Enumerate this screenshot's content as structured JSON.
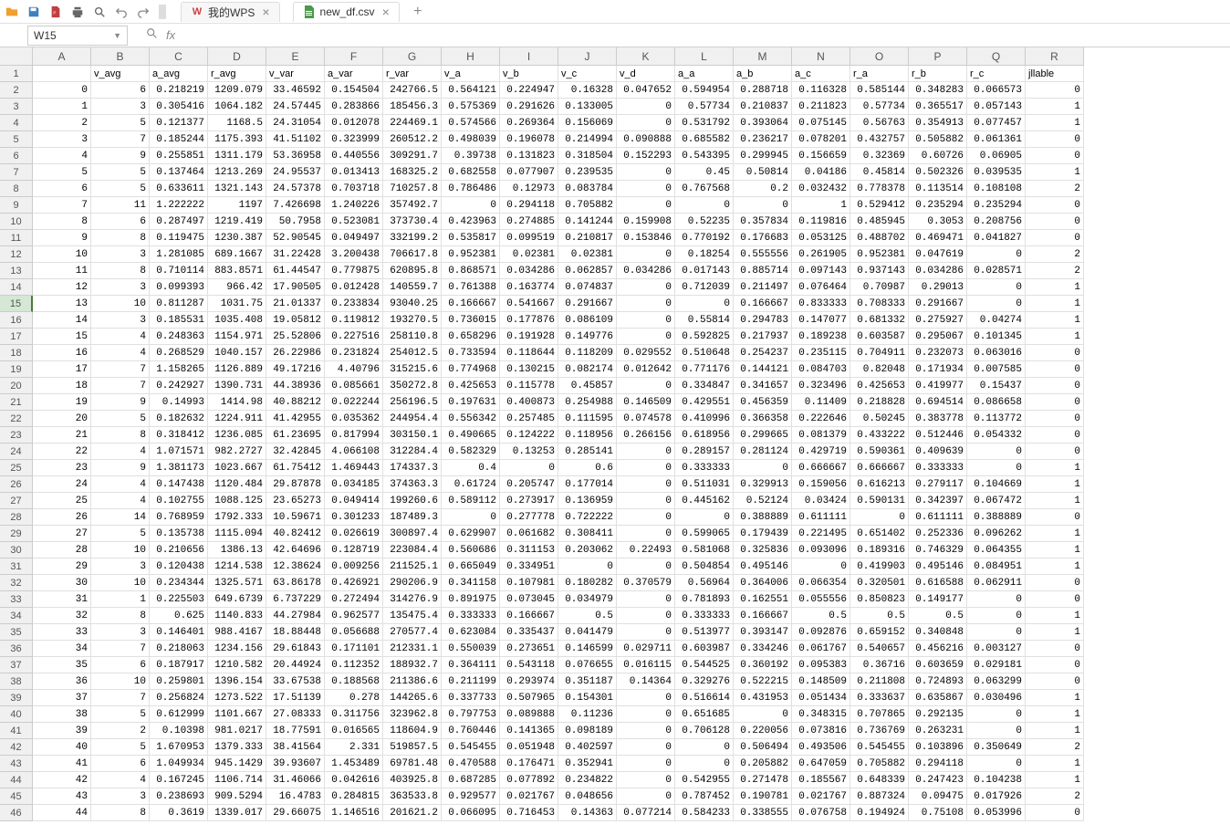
{
  "toolbar": {
    "tabs": [
      {
        "label": "我的WPS",
        "active": false,
        "closable": true,
        "icon": "wps"
      },
      {
        "label": "new_df.csv",
        "active": true,
        "closable": true,
        "icon": "csv"
      }
    ]
  },
  "namebox": {
    "value": "W15"
  },
  "formula": {
    "label": "fx",
    "value": ""
  },
  "columns": [
    "A",
    "B",
    "C",
    "D",
    "E",
    "F",
    "G",
    "H",
    "I",
    "J",
    "K",
    "L",
    "M",
    "N",
    "O",
    "P",
    "Q",
    "R"
  ],
  "selected": {
    "row": 15,
    "col": "W"
  },
  "headers_row": [
    "",
    "v_avg",
    "a_avg",
    "r_avg",
    "v_var",
    "a_var",
    "r_var",
    "v_a",
    "v_b",
    "v_c",
    "v_d",
    "a_a",
    "a_b",
    "a_c",
    "r_a",
    "r_b",
    "r_c",
    "jllable"
  ],
  "data_rows": [
    [
      "0",
      "6",
      "0.218219",
      "1209.079",
      "33.46592",
      "0.154504",
      "242766.5",
      "0.564121",
      "0.224947",
      "0.16328",
      "0.047652",
      "0.594954",
      "0.288718",
      "0.116328",
      "0.585144",
      "0.348283",
      "0.066573",
      "0"
    ],
    [
      "1",
      "3",
      "0.305416",
      "1064.182",
      "24.57445",
      "0.283866",
      "185456.3",
      "0.575369",
      "0.291626",
      "0.133005",
      "0",
      "0.57734",
      "0.210837",
      "0.211823",
      "0.57734",
      "0.365517",
      "0.057143",
      "1"
    ],
    [
      "2",
      "5",
      "0.121377",
      "1168.5",
      "24.31054",
      "0.012078",
      "224469.1",
      "0.574566",
      "0.269364",
      "0.156069",
      "0",
      "0.531792",
      "0.393064",
      "0.075145",
      "0.56763",
      "0.354913",
      "0.077457",
      "1"
    ],
    [
      "3",
      "7",
      "0.185244",
      "1175.393",
      "41.51102",
      "0.323999",
      "260512.2",
      "0.498039",
      "0.196078",
      "0.214994",
      "0.090888",
      "0.685582",
      "0.236217",
      "0.078201",
      "0.432757",
      "0.505882",
      "0.061361",
      "0"
    ],
    [
      "4",
      "9",
      "0.255851",
      "1311.179",
      "53.36958",
      "0.440556",
      "309291.7",
      "0.39738",
      "0.131823",
      "0.318504",
      "0.152293",
      "0.543395",
      "0.299945",
      "0.156659",
      "0.32369",
      "0.60726",
      "0.06905",
      "0"
    ],
    [
      "5",
      "5",
      "0.137464",
      "1213.269",
      "24.95537",
      "0.013413",
      "168325.2",
      "0.682558",
      "0.077907",
      "0.239535",
      "0",
      "0.45",
      "0.50814",
      "0.04186",
      "0.45814",
      "0.502326",
      "0.039535",
      "1"
    ],
    [
      "6",
      "5",
      "0.633611",
      "1321.143",
      "24.57378",
      "0.703718",
      "710257.8",
      "0.786486",
      "0.12973",
      "0.083784",
      "0",
      "0.767568",
      "0.2",
      "0.032432",
      "0.778378",
      "0.113514",
      "0.108108",
      "2"
    ],
    [
      "7",
      "11",
      "1.222222",
      "1197",
      "7.426698",
      "1.240226",
      "357492.7",
      "0",
      "0.294118",
      "0.705882",
      "0",
      "0",
      "0",
      "1",
      "0.529412",
      "0.235294",
      "0.235294",
      "0"
    ],
    [
      "8",
      "6",
      "0.287497",
      "1219.419",
      "50.7958",
      "0.523081",
      "373730.4",
      "0.423963",
      "0.274885",
      "0.141244",
      "0.159908",
      "0.52235",
      "0.357834",
      "0.119816",
      "0.485945",
      "0.3053",
      "0.208756",
      "0"
    ],
    [
      "9",
      "8",
      "0.119475",
      "1230.387",
      "52.90545",
      "0.049497",
      "332199.2",
      "0.535817",
      "0.099519",
      "0.210817",
      "0.153846",
      "0.770192",
      "0.176683",
      "0.053125",
      "0.488702",
      "0.469471",
      "0.041827",
      "0"
    ],
    [
      "10",
      "3",
      "1.281085",
      "689.1667",
      "31.22428",
      "3.200438",
      "706617.8",
      "0.952381",
      "0.02381",
      "0.02381",
      "0",
      "0.18254",
      "0.555556",
      "0.261905",
      "0.952381",
      "0.047619",
      "0",
      "2"
    ],
    [
      "11",
      "8",
      "0.710114",
      "883.8571",
      "61.44547",
      "0.779875",
      "620895.8",
      "0.868571",
      "0.034286",
      "0.062857",
      "0.034286",
      "0.017143",
      "0.885714",
      "0.097143",
      "0.937143",
      "0.034286",
      "0.028571",
      "2"
    ],
    [
      "12",
      "3",
      "0.099393",
      "966.42",
      "17.90505",
      "0.012428",
      "140559.7",
      "0.761388",
      "0.163774",
      "0.074837",
      "0",
      "0.712039",
      "0.211497",
      "0.076464",
      "0.70987",
      "0.29013",
      "0",
      "1"
    ],
    [
      "13",
      "10",
      "0.811287",
      "1031.75",
      "21.01337",
      "0.233834",
      "93040.25",
      "0.166667",
      "0.541667",
      "0.291667",
      "0",
      "0",
      "0.166667",
      "0.833333",
      "0.708333",
      "0.291667",
      "0",
      "1"
    ],
    [
      "14",
      "3",
      "0.185531",
      "1035.408",
      "19.05812",
      "0.119812",
      "193270.5",
      "0.736015",
      "0.177876",
      "0.086109",
      "0",
      "0.55814",
      "0.294783",
      "0.147077",
      "0.681332",
      "0.275927",
      "0.04274",
      "1"
    ],
    [
      "15",
      "4",
      "0.248363",
      "1154.971",
      "25.52806",
      "0.227516",
      "258110.8",
      "0.658296",
      "0.191928",
      "0.149776",
      "0",
      "0.592825",
      "0.217937",
      "0.189238",
      "0.603587",
      "0.295067",
      "0.101345",
      "1"
    ],
    [
      "16",
      "4",
      "0.268529",
      "1040.157",
      "26.22986",
      "0.231824",
      "254012.5",
      "0.733594",
      "0.118644",
      "0.118209",
      "0.029552",
      "0.510648",
      "0.254237",
      "0.235115",
      "0.704911",
      "0.232073",
      "0.063016",
      "0"
    ],
    [
      "17",
      "7",
      "1.158265",
      "1126.889",
      "49.17216",
      "4.40796",
      "315215.6",
      "0.774968",
      "0.130215",
      "0.082174",
      "0.012642",
      "0.771176",
      "0.144121",
      "0.084703",
      "0.82048",
      "0.171934",
      "0.007585",
      "0"
    ],
    [
      "18",
      "7",
      "0.242927",
      "1390.731",
      "44.38936",
      "0.085661",
      "350272.8",
      "0.425653",
      "0.115778",
      "0.45857",
      "0",
      "0.334847",
      "0.341657",
      "0.323496",
      "0.425653",
      "0.419977",
      "0.15437",
      "0"
    ],
    [
      "19",
      "9",
      "0.14993",
      "1414.98",
      "40.88212",
      "0.022244",
      "256196.5",
      "0.197631",
      "0.400873",
      "0.254988",
      "0.146509",
      "0.429551",
      "0.456359",
      "0.11409",
      "0.218828",
      "0.694514",
      "0.086658",
      "0"
    ],
    [
      "20",
      "5",
      "0.182632",
      "1224.911",
      "41.42955",
      "0.035362",
      "244954.4",
      "0.556342",
      "0.257485",
      "0.111595",
      "0.074578",
      "0.410996",
      "0.366358",
      "0.222646",
      "0.50245",
      "0.383778",
      "0.113772",
      "0"
    ],
    [
      "21",
      "8",
      "0.318412",
      "1236.085",
      "61.23695",
      "0.817994",
      "303150.1",
      "0.490665",
      "0.124222",
      "0.118956",
      "0.266156",
      "0.618956",
      "0.299665",
      "0.081379",
      "0.433222",
      "0.512446",
      "0.054332",
      "0"
    ],
    [
      "22",
      "4",
      "1.071571",
      "982.2727",
      "32.42845",
      "4.066108",
      "312284.4",
      "0.582329",
      "0.13253",
      "0.285141",
      "0",
      "0.289157",
      "0.281124",
      "0.429719",
      "0.590361",
      "0.409639",
      "0",
      "0"
    ],
    [
      "23",
      "9",
      "1.381173",
      "1023.667",
      "61.75412",
      "1.469443",
      "174337.3",
      "0.4",
      "0",
      "0.6",
      "0",
      "0.333333",
      "0",
      "0.666667",
      "0.666667",
      "0.333333",
      "0",
      "1"
    ],
    [
      "24",
      "4",
      "0.147438",
      "1120.484",
      "29.87878",
      "0.034185",
      "374363.3",
      "0.61724",
      "0.205747",
      "0.177014",
      "0",
      "0.511031",
      "0.329913",
      "0.159056",
      "0.616213",
      "0.279117",
      "0.104669",
      "1"
    ],
    [
      "25",
      "4",
      "0.102755",
      "1088.125",
      "23.65273",
      "0.049414",
      "199260.6",
      "0.589112",
      "0.273917",
      "0.136959",
      "0",
      "0.445162",
      "0.52124",
      "0.03424",
      "0.590131",
      "0.342397",
      "0.067472",
      "1"
    ],
    [
      "26",
      "14",
      "0.768959",
      "1792.333",
      "10.59671",
      "0.301233",
      "187489.3",
      "0",
      "0.277778",
      "0.722222",
      "0",
      "0",
      "0.388889",
      "0.611111",
      "0",
      "0.611111",
      "0.388889",
      "0"
    ],
    [
      "27",
      "5",
      "0.135738",
      "1115.094",
      "40.82412",
      "0.026619",
      "300897.4",
      "0.629907",
      "0.061682",
      "0.308411",
      "0",
      "0.599065",
      "0.179439",
      "0.221495",
      "0.651402",
      "0.252336",
      "0.096262",
      "1"
    ],
    [
      "28",
      "10",
      "0.210656",
      "1386.13",
      "42.64696",
      "0.128719",
      "223084.4",
      "0.560686",
      "0.311153",
      "0.203062",
      "0.22493",
      "0.581068",
      "0.325836",
      "0.093096",
      "0.189316",
      "0.746329",
      "0.064355",
      "1"
    ],
    [
      "29",
      "3",
      "0.120438",
      "1214.538",
      "12.38624",
      "0.009256",
      "211525.1",
      "0.665049",
      "0.334951",
      "0",
      "0",
      "0.504854",
      "0.495146",
      "0",
      "0.419903",
      "0.495146",
      "0.084951",
      "1"
    ],
    [
      "30",
      "10",
      "0.234344",
      "1325.571",
      "63.86178",
      "0.426921",
      "290206.9",
      "0.341158",
      "0.107981",
      "0.180282",
      "0.370579",
      "0.56964",
      "0.364006",
      "0.066354",
      "0.320501",
      "0.616588",
      "0.062911",
      "0"
    ],
    [
      "31",
      "1",
      "0.225503",
      "649.6739",
      "6.737229",
      "0.272494",
      "314276.9",
      "0.891975",
      "0.073045",
      "0.034979",
      "0",
      "0.781893",
      "0.162551",
      "0.055556",
      "0.850823",
      "0.149177",
      "0",
      "0"
    ],
    [
      "32",
      "8",
      "0.625",
      "1140.833",
      "44.27984",
      "0.962577",
      "135475.4",
      "0.333333",
      "0.166667",
      "0.5",
      "0",
      "0.333333",
      "0.166667",
      "0.5",
      "0.5",
      "0.5",
      "0",
      "1"
    ],
    [
      "33",
      "3",
      "0.146401",
      "988.4167",
      "18.88448",
      "0.056688",
      "270577.4",
      "0.623084",
      "0.335437",
      "0.041479",
      "0",
      "0.513977",
      "0.393147",
      "0.092876",
      "0.659152",
      "0.340848",
      "0",
      "1"
    ],
    [
      "34",
      "7",
      "0.218063",
      "1234.156",
      "29.61843",
      "0.171101",
      "212331.1",
      "0.550039",
      "0.273651",
      "0.146599",
      "0.029711",
      "0.603987",
      "0.334246",
      "0.061767",
      "0.540657",
      "0.456216",
      "0.003127",
      "0"
    ],
    [
      "35",
      "6",
      "0.187917",
      "1210.582",
      "20.44924",
      "0.112352",
      "188932.7",
      "0.364111",
      "0.543118",
      "0.076655",
      "0.016115",
      "0.544525",
      "0.360192",
      "0.095383",
      "0.36716",
      "0.603659",
      "0.029181",
      "0"
    ],
    [
      "36",
      "10",
      "0.259801",
      "1396.154",
      "33.67538",
      "0.188568",
      "211386.6",
      "0.211199",
      "0.293974",
      "0.351187",
      "0.14364",
      "0.329276",
      "0.522215",
      "0.148509",
      "0.211808",
      "0.724893",
      "0.063299",
      "0"
    ],
    [
      "37",
      "7",
      "0.256824",
      "1273.522",
      "17.51139",
      "0.278",
      "144265.6",
      "0.337733",
      "0.507965",
      "0.154301",
      "0",
      "0.516614",
      "0.431953",
      "0.051434",
      "0.333637",
      "0.635867",
      "0.030496",
      "1"
    ],
    [
      "38",
      "5",
      "0.612999",
      "1101.667",
      "27.08333",
      "0.311756",
      "323962.8",
      "0.797753",
      "0.089888",
      "0.11236",
      "0",
      "0.651685",
      "0",
      "0.348315",
      "0.707865",
      "0.292135",
      "0",
      "1"
    ],
    [
      "39",
      "2",
      "0.10398",
      "981.0217",
      "18.77591",
      "0.016565",
      "118604.9",
      "0.760446",
      "0.141365",
      "0.098189",
      "0",
      "0.706128",
      "0.220056",
      "0.073816",
      "0.736769",
      "0.263231",
      "0",
      "1"
    ],
    [
      "40",
      "5",
      "1.670953",
      "1379.333",
      "38.41564",
      "2.331",
      "519857.5",
      "0.545455",
      "0.051948",
      "0.402597",
      "0",
      "0",
      "0.506494",
      "0.493506",
      "0.545455",
      "0.103896",
      "0.350649",
      "2"
    ],
    [
      "41",
      "6",
      "1.049934",
      "945.1429",
      "39.93607",
      "1.453489",
      "69781.48",
      "0.470588",
      "0.176471",
      "0.352941",
      "0",
      "0",
      "0.205882",
      "0.647059",
      "0.705882",
      "0.294118",
      "0",
      "1"
    ],
    [
      "42",
      "4",
      "0.167245",
      "1106.714",
      "31.46066",
      "0.042616",
      "403925.8",
      "0.687285",
      "0.077892",
      "0.234822",
      "0",
      "0.542955",
      "0.271478",
      "0.185567",
      "0.648339",
      "0.247423",
      "0.104238",
      "1"
    ],
    [
      "43",
      "3",
      "0.238693",
      "909.5294",
      "16.4783",
      "0.284815",
      "363533.8",
      "0.929577",
      "0.021767",
      "0.048656",
      "0",
      "0.787452",
      "0.190781",
      "0.021767",
      "0.887324",
      "0.09475",
      "0.017926",
      "2"
    ],
    [
      "44",
      "8",
      "0.3619",
      "1339.017",
      "29.66075",
      "1.146516",
      "201621.2",
      "0.066095",
      "0.716453",
      "0.14363",
      "0.077214",
      "0.584233",
      "0.338555",
      "0.076758",
      "0.194924",
      "0.75108",
      "0.053996",
      "0"
    ]
  ]
}
